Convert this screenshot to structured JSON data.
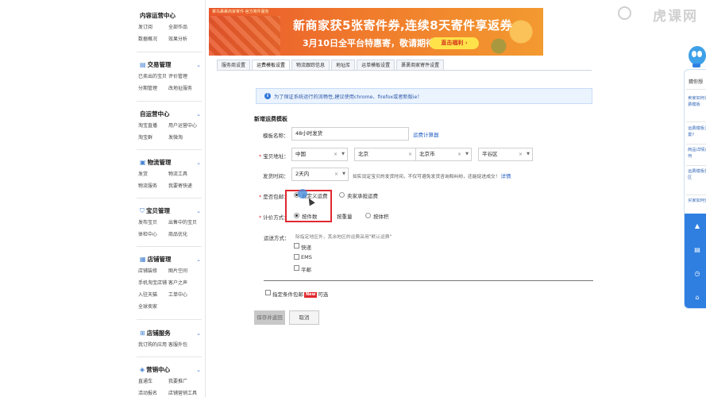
{
  "sidebar": {
    "sections": [
      {
        "title": "内容运营中心",
        "icon": "",
        "links": [
          "发订阅",
          "全部作品",
          "数据概况",
          "效果分析"
        ]
      },
      {
        "title": "交易管理",
        "icon": "trade-icon",
        "links": [
          "已卖出的宝贝",
          "评价管理",
          "分期管理",
          "改地址服务"
        ]
      },
      {
        "title": "自运营中心",
        "icon": "",
        "links": [
          "淘宝直播",
          "用户运营中心",
          "淘宝群",
          "发微淘"
        ]
      },
      {
        "title": "物流管理",
        "icon": "logistics-icon",
        "links": [
          "发货",
          "物流工具",
          "物流服务",
          "我要寄快递"
        ]
      },
      {
        "title": "宝贝管理",
        "icon": "goods-icon",
        "links": [
          "发布宝贝",
          "出售中的宝贝",
          "体检中心",
          "商品优化"
        ]
      },
      {
        "title": "店铺管理",
        "icon": "shop-icon",
        "links": [
          "店铺装修",
          "图片空间",
          "手机淘宝店铺",
          "客户之声",
          "入驻天猫",
          "工单中心",
          "全球卖家",
          ""
        ]
      },
      {
        "title": "店铺服务",
        "icon": "service-icon",
        "links": [
          "我订购的应用",
          "客服外包"
        ]
      },
      {
        "title": "营销中心",
        "icon": "marketing-icon",
        "links": [
          "直通车",
          "我要推广",
          "活动报名",
          "店铺营销工具"
        ]
      }
    ]
  },
  "banner": {
    "tag": "菜鸟裹裹商家寄件·官方寄件服务",
    "headline": "新商家获5张寄件券,连续8天寄件享返券",
    "subline": "3月10日全平台特惠寄，敬请期待…",
    "button": "直击福利 ›"
  },
  "tabs": [
    "服务商设置",
    "运费模板设置",
    "物流跟踪信息",
    "地址库",
    "运单模板设置",
    "裹裹商家寄件设置"
  ],
  "active_tab": "运费模板设置",
  "notice": "为了保证系统运行的流畅性,建议使用chrome、firefox或者新版ie！",
  "form": {
    "title": "新增运费模板",
    "template_name_label": "模板名称：",
    "template_name_value": "48小时发货",
    "calculator_link": "运费计算器",
    "address_label": "宝贝地址：",
    "address": [
      "中国",
      "北京",
      "北京市",
      "平谷区"
    ],
    "ship_time_label": "发货时间：",
    "ship_time_value": "2天内",
    "ship_time_hint": "如实设定宝贝的发货时间，不仅可避免发货咨询和纠纷，还能促进成交！",
    "ship_time_hint_link": "详情",
    "free_ship_label": "是否包邮：",
    "free_ship_options": [
      "自定义运费",
      "卖家承担运费"
    ],
    "pricing_label": "计价方式：",
    "pricing_options": [
      "按件数",
      "按重量",
      "按体积"
    ],
    "method_label": "运送方式：",
    "method_hint": "除指定地区外，其余地区的运费采用\"默认运费\"",
    "methods": [
      "快递",
      "EMS",
      "平邮"
    ],
    "conditional_label": "指定条件包邮",
    "new_badge": "New",
    "conditional_suffix": "可选",
    "save_button": "保存并返回",
    "cancel_button": "取消"
  },
  "watermark": "虎课网",
  "right_panel": {
    "title": "猜你想",
    "questions": [
      "卖家如何设置运费模板",
      "运费模板怎么设置?",
      "商品详情运费如何",
      "运费模板部分地区",
      "买家如何查询"
    ]
  }
}
